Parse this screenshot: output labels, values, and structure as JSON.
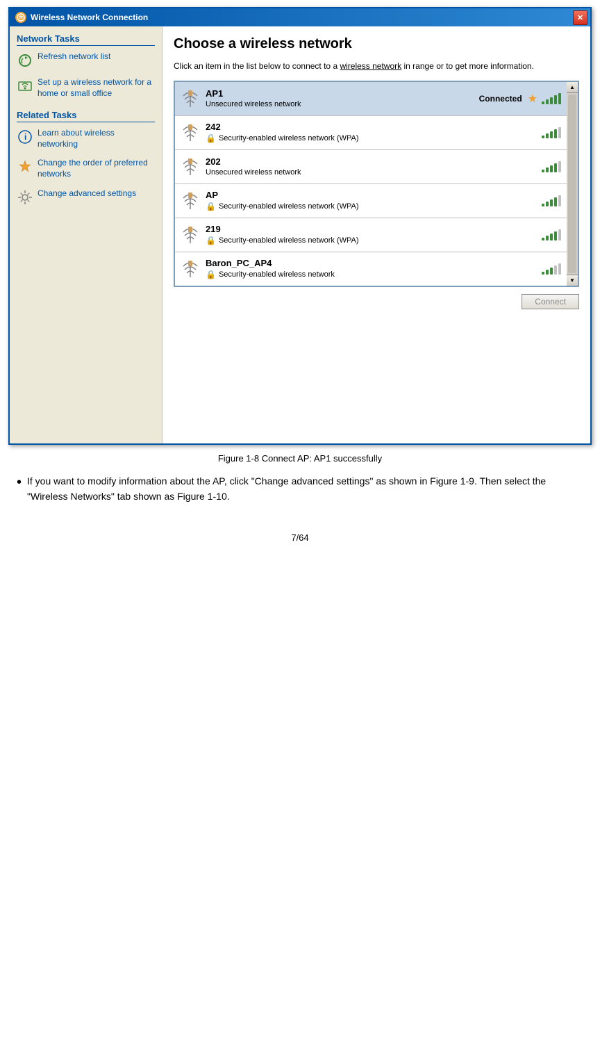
{
  "window": {
    "title": "Wireless Network Connection",
    "close_label": "✕",
    "icon_label": "n"
  },
  "main": {
    "title": "Choose a wireless network",
    "description": "Click an item in the list below to connect to a wireless network in range or to get more information.",
    "connect_button": "Connect"
  },
  "sidebar": {
    "network_tasks_title": "Network Tasks",
    "related_tasks_title": "Related Tasks",
    "items": [
      {
        "id": "refresh",
        "label": "Refresh network list"
      },
      {
        "id": "setup",
        "label": "Set up a wireless network for a home or small office"
      },
      {
        "id": "learn",
        "label": "Learn about wireless networking"
      },
      {
        "id": "order",
        "label": "Change the order of preferred networks"
      },
      {
        "id": "advanced",
        "label": "Change advanced settings"
      }
    ]
  },
  "networks": [
    {
      "ssid": "AP1",
      "connected": true,
      "connected_label": "Connected",
      "security": "Unsecured wireless network",
      "secured": false,
      "signal": 5
    },
    {
      "ssid": "242",
      "connected": false,
      "security": "Security-enabled wireless network (WPA)",
      "secured": true,
      "signal": 4
    },
    {
      "ssid": "202",
      "connected": false,
      "security": "Unsecured wireless network",
      "secured": false,
      "signal": 4
    },
    {
      "ssid": "AP",
      "connected": false,
      "security": "Security-enabled wireless network (WPA)",
      "secured": true,
      "signal": 4
    },
    {
      "ssid": "219",
      "connected": false,
      "security": "Security-enabled wireless network (WPA)",
      "secured": true,
      "signal": 4
    },
    {
      "ssid": "Baron_PC_AP4",
      "connected": false,
      "security": "Security-enabled wireless network",
      "secured": true,
      "signal": 3
    }
  ],
  "caption": "Figure 1-8 Connect AP: AP1 successfully",
  "body_text": "If you want to modify information about the AP, click \"Change advanced settings\" as shown in Figure 1-9. Then select the \"Wireless Networks\" tab shown as Figure 1-10.",
  "page_number": "7/64"
}
